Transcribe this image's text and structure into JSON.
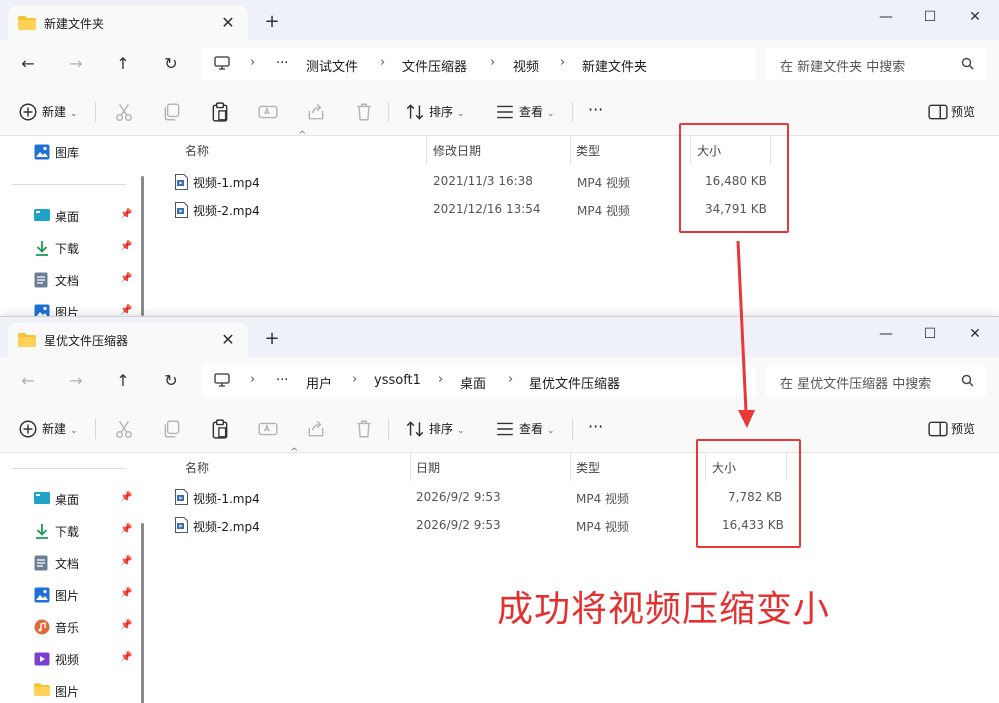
{
  "window_top": {
    "tab_title": "新建文件夹",
    "breadcrumb": [
      "测试文件",
      "文件压缩器",
      "视频",
      "新建文件夹"
    ],
    "search_placeholder": "在 新建文件夹 中搜索",
    "sidebar": [
      {
        "label": "图库",
        "icon": "gallery-icon"
      },
      {
        "label": "桌面",
        "icon": "desktop-icon",
        "pinned": true
      },
      {
        "label": "下载",
        "icon": "download-icon",
        "pinned": true
      },
      {
        "label": "文档",
        "icon": "document-icon",
        "pinned": true
      },
      {
        "label": "图片",
        "icon": "picture-icon",
        "pinned": true
      }
    ],
    "columns": {
      "name": "名称",
      "date": "修改日期",
      "type": "类型",
      "size": "大小"
    },
    "files": [
      {
        "name": "视频-1.mp4",
        "date": "2021/11/3 16:38",
        "type": "MP4 视频",
        "size": "16,480 KB"
      },
      {
        "name": "视频-2.mp4",
        "date": "2021/12/16 13:54",
        "type": "MP4 视频",
        "size": "34,791 KB"
      }
    ]
  },
  "window_bottom": {
    "tab_title": "星优文件压缩器",
    "breadcrumb": [
      "用户",
      "yssoft1",
      "桌面",
      "星优文件压缩器"
    ],
    "search_placeholder": "在 星优文件压缩器 中搜索",
    "sidebar": [
      {
        "label": "桌面",
        "icon": "desktop-icon",
        "pinned": true
      },
      {
        "label": "下载",
        "icon": "download-icon",
        "pinned": true
      },
      {
        "label": "文档",
        "icon": "document-icon",
        "pinned": true
      },
      {
        "label": "图片",
        "icon": "picture-icon",
        "pinned": true
      },
      {
        "label": "音乐",
        "icon": "music-icon",
        "pinned": true
      },
      {
        "label": "视频",
        "icon": "video-icon",
        "pinned": true
      },
      {
        "label": "图片",
        "icon": "folder-icon",
        "pinned": false
      }
    ],
    "columns": {
      "name": "名称",
      "date": "日期",
      "type": "类型",
      "size": "大小"
    },
    "files": [
      {
        "name": "视频-1.mp4",
        "date": "2026/9/2 9:53",
        "type": "MP4 视频",
        "size": "7,782 KB"
      },
      {
        "name": "视频-2.mp4",
        "date": "2026/9/2 9:53",
        "type": "MP4 视频",
        "size": "16,433 KB"
      }
    ]
  },
  "toolbar": {
    "new_label": "新建",
    "sort_label": "排序",
    "view_label": "查看",
    "more_label": "···",
    "preview_label": "预览"
  },
  "window_controls": {
    "minimize": "—",
    "maximize": "☐",
    "close": "✕"
  },
  "annotation": {
    "text": "成功将视频压缩变小",
    "color": "#e53030"
  }
}
